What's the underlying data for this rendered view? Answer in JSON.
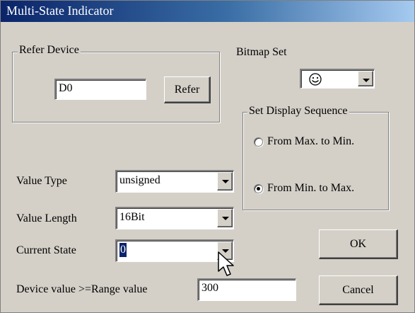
{
  "window": {
    "title": "Multi-State Indicator"
  },
  "refer_device": {
    "legend": "Refer Device",
    "value": "D0",
    "button_label": "Refer"
  },
  "bitmap_set": {
    "label": "Bitmap Set",
    "selected": "smiley-face-icon"
  },
  "display_sequence": {
    "legend": "Set Display Sequence",
    "options": [
      {
        "label": "From Max. to Min.",
        "checked": false
      },
      {
        "label": "From Min. to Max.",
        "checked": true
      }
    ]
  },
  "value_type": {
    "label": "Value Type",
    "value": "unsigned"
  },
  "value_length": {
    "label": "Value Length",
    "value": "16Bit"
  },
  "current_state": {
    "label": "Current State",
    "value": "0"
  },
  "range": {
    "label": "Device value >=Range value",
    "value": "300"
  },
  "buttons": {
    "ok": "OK",
    "cancel": "Cancel"
  },
  "colors": {
    "dialog_bg": "#d4d0c8",
    "titlebar_start": "#0a246a",
    "titlebar_end": "#a6caf0",
    "selection": "#0a246a"
  }
}
